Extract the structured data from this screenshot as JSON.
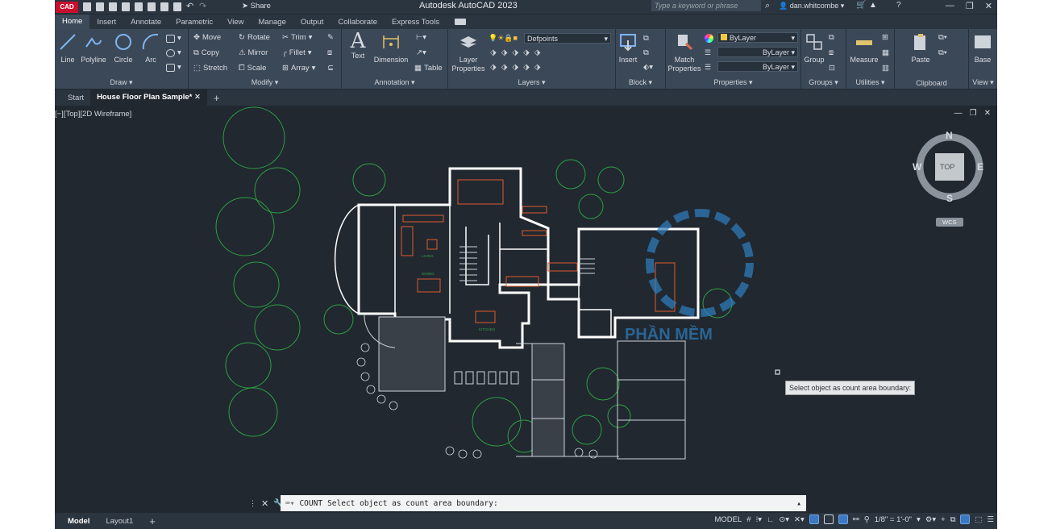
{
  "titlebar": {
    "logo": "CAD",
    "share": "Share",
    "title": "Autodesk AutoCAD 2023",
    "search_placeholder": "Type a keyword or phrase",
    "user": "dan.whitcombe"
  },
  "tabs": [
    "Home",
    "Insert",
    "Annotate",
    "Parametric",
    "View",
    "Manage",
    "Output",
    "Collaborate",
    "Express Tools"
  ],
  "ribbon": {
    "draw": {
      "title": "Draw",
      "line": "Line",
      "polyline": "Polyline",
      "circle": "Circle",
      "arc": "Arc"
    },
    "modify": {
      "title": "Modify",
      "move": "Move",
      "rotate": "Rotate",
      "trim": "Trim",
      "copy": "Copy",
      "mirror": "Mirror",
      "fillet": "Fillet",
      "stretch": "Stretch",
      "scale": "Scale",
      "array": "Array"
    },
    "annotation": {
      "title": "Annotation",
      "text": "Text",
      "dimension": "Dimension",
      "table": "Table"
    },
    "layers": {
      "title": "Layers",
      "layer_properties": "Layer Properties",
      "current_layer": "Defpoints"
    },
    "block": {
      "title": "Block",
      "insert": "Insert"
    },
    "properties": {
      "title": "Properties",
      "match": "Match Properties",
      "color": "ByLayer",
      "linetype": "ByLayer",
      "lineweight": "ByLayer"
    },
    "groups": {
      "title": "Groups",
      "group": "Group"
    },
    "utilities": {
      "title": "Utilities",
      "measure": "Measure"
    },
    "clipboard": {
      "title": "Clipboard",
      "paste": "Paste"
    },
    "view": {
      "title": "View",
      "base": "Base"
    }
  },
  "doctabs": {
    "start": "Start",
    "current": "House Floor Plan Sample*"
  },
  "viewport": {
    "label": "[−][Top][2D Wireframe]",
    "compass": {
      "n": "N",
      "s": "S",
      "e": "E",
      "w": "W",
      "top": "TOP",
      "wcs": "WCS"
    }
  },
  "plan": {
    "living": "LIVING",
    "dining": "DINING",
    "kitchen": "KITCHEN"
  },
  "watermark": "PHẦN MỀM",
  "tooltip": "Select object as count area boundary:",
  "command": {
    "name": "COUNT",
    "prompt": "Select object as count area boundary:"
  },
  "status": {
    "model_tab": "Model",
    "layout_tab": "Layout1",
    "model": "MODEL",
    "scale": "1/8\" = 1'-0\""
  },
  "colors": {
    "canvas": "#212830",
    "ribbon": "#3b4858",
    "tree": "#2ea043",
    "wall": "#ffffff",
    "furniture": "#e05a2b",
    "accent": "#3d78c2"
  }
}
